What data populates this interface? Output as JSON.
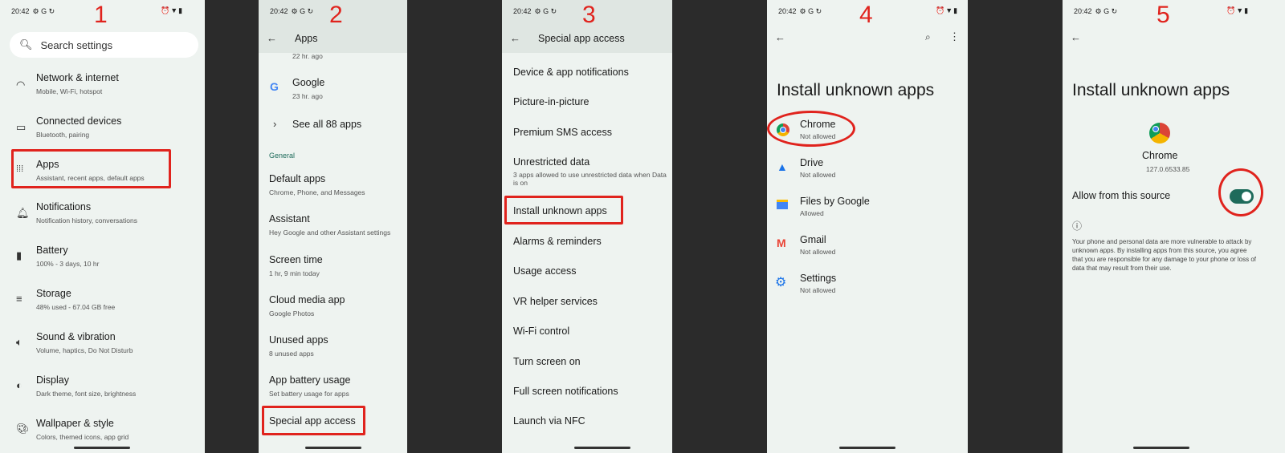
{
  "steps": [
    "1",
    "2",
    "3",
    "4",
    "5"
  ],
  "status_time": "20:42",
  "panel1": {
    "search_placeholder": "Search settings",
    "items": [
      {
        "title": "Network & internet",
        "sub": "Mobile, Wi-Fi, hotspot",
        "icon": "wifi-icon"
      },
      {
        "title": "Connected devices",
        "sub": "Bluetooth, pairing",
        "icon": "devices-icon"
      },
      {
        "title": "Apps",
        "sub": "Assistant, recent apps, default apps",
        "icon": "apps-grid-icon"
      },
      {
        "title": "Notifications",
        "sub": "Notification history, conversations",
        "icon": "bell-icon"
      },
      {
        "title": "Battery",
        "sub": "100% - 3 days, 10 hr",
        "icon": "battery-icon"
      },
      {
        "title": "Storage",
        "sub": "48% used - 67.04 GB free",
        "icon": "storage-icon"
      },
      {
        "title": "Sound & vibration",
        "sub": "Volume, haptics, Do Not Disturb",
        "icon": "speaker-icon"
      },
      {
        "title": "Display",
        "sub": "Dark theme, font size, brightness",
        "icon": "brightness-icon"
      },
      {
        "title": "Wallpaper & style",
        "sub": "Colors, themed icons, app grid",
        "icon": "palette-icon"
      }
    ]
  },
  "panel2": {
    "title": "Apps",
    "top_sub": "22 hr. ago",
    "google": {
      "title": "Google",
      "sub": "23 hr. ago"
    },
    "see_all": "See all 88 apps",
    "section": "General",
    "items": [
      {
        "title": "Default apps",
        "sub": "Chrome, Phone, and Messages"
      },
      {
        "title": "Assistant",
        "sub": "Hey Google and other Assistant settings"
      },
      {
        "title": "Screen time",
        "sub": "1 hr, 9 min today"
      },
      {
        "title": "Cloud media app",
        "sub": "Google Photos"
      },
      {
        "title": "Unused apps",
        "sub": "8 unused apps"
      },
      {
        "title": "App battery usage",
        "sub": "Set battery usage for apps"
      }
    ],
    "special": "Special app access"
  },
  "panel3": {
    "title": "Special app access",
    "items": [
      {
        "title": "Device & app notifications",
        "sub": ""
      },
      {
        "title": "Picture-in-picture",
        "sub": ""
      },
      {
        "title": "Premium SMS access",
        "sub": ""
      },
      {
        "title": "Unrestricted data",
        "sub": "3 apps allowed to use unrestricted data when Data",
        "sub2": "is on"
      },
      {
        "title": "Install unknown apps",
        "sub": ""
      },
      {
        "title": "Alarms & reminders",
        "sub": ""
      },
      {
        "title": "Usage access",
        "sub": ""
      },
      {
        "title": "VR helper services",
        "sub": ""
      },
      {
        "title": "Wi-Fi control",
        "sub": ""
      },
      {
        "title": "Turn screen on",
        "sub": ""
      },
      {
        "title": "Full screen notifications",
        "sub": ""
      },
      {
        "title": "Launch via NFC",
        "sub": ""
      }
    ]
  },
  "panel4": {
    "title": "Install unknown apps",
    "apps": [
      {
        "name": "Chrome",
        "status": "Not allowed"
      },
      {
        "name": "Drive",
        "status": "Not allowed"
      },
      {
        "name": "Files by Google",
        "status": "Allowed"
      },
      {
        "name": "Gmail",
        "status": "Not allowed"
      },
      {
        "name": "Settings",
        "status": "Not allowed"
      }
    ]
  },
  "panel5": {
    "title": "Install unknown apps",
    "app_name": "Chrome",
    "version": "127.0.6533.85",
    "toggle_label": "Allow from this source",
    "toggle_on": true,
    "warning": "Your phone and personal data are more vulnerable to attack by unknown apps. By installing apps from this source, you agree that you are responsible for any damage to your phone or loss of data that may result from their use."
  },
  "colors": {
    "accent": "#e0231d",
    "toggle": "#1e6b5b",
    "panel_bg": "#eef3f0"
  }
}
